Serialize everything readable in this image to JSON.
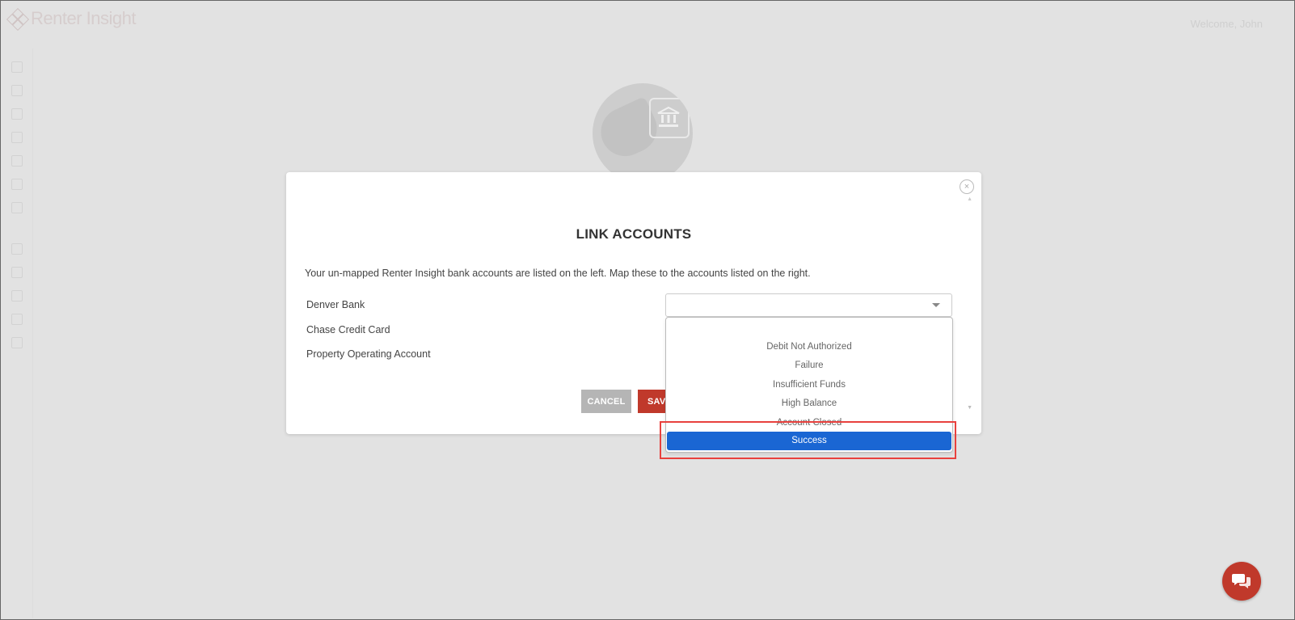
{
  "app": {
    "logo_text": "Renter Insight",
    "welcome_text": "Welcome, John"
  },
  "modal": {
    "title": "LINK ACCOUNTS",
    "instructions": "Your un-mapped Renter Insight bank accounts are listed on the left. Map these to the accounts listed on the right.",
    "accounts": [
      "Denver Bank",
      "Chase Credit Card",
      "Property Operating Account"
    ],
    "select_value": "",
    "cancel_label": "CANCEL",
    "save_label": "SAVE"
  },
  "dropdown": {
    "options": [
      "Debit Not Authorized",
      "Failure",
      "Insufficient Funds",
      "High Balance",
      "Account Closed",
      "Success"
    ],
    "selected": "Success"
  },
  "colors": {
    "accent": "#c0392b",
    "selected_option": "#1a66d3",
    "highlight": "#e8413e"
  }
}
